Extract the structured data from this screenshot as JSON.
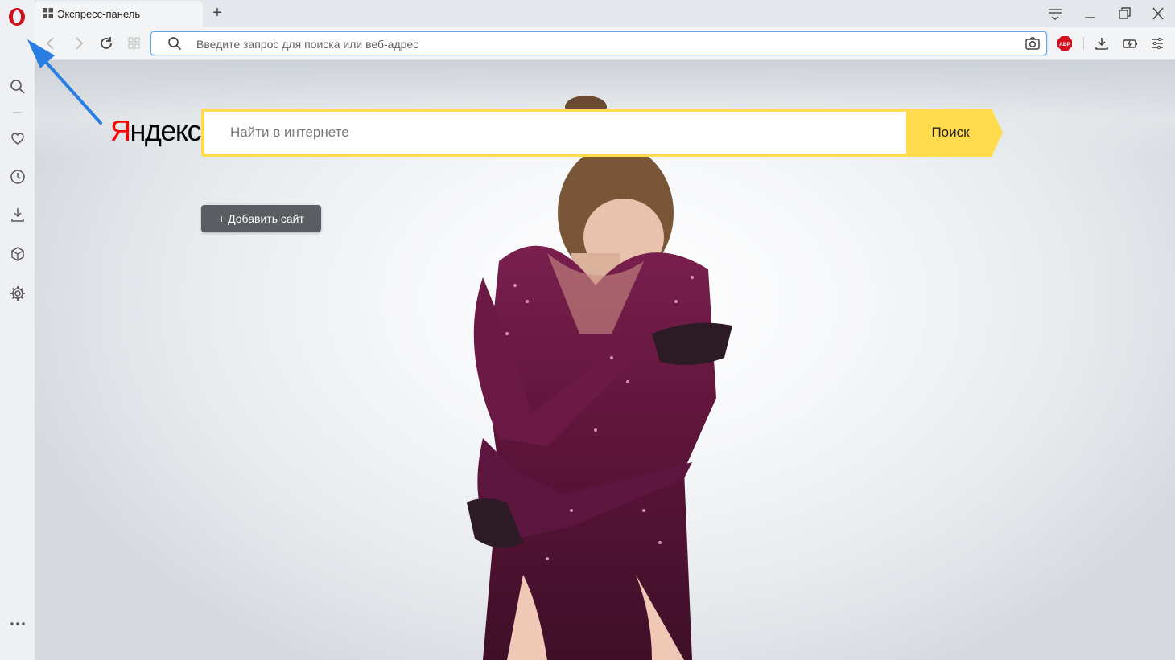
{
  "browser": {
    "tab": {
      "title": "Экспресс-панель",
      "icon": "grid-icon"
    },
    "new_tab_label": "+",
    "address_bar": {
      "value": "",
      "placeholder": "Введите запрос для поиска или веб-адрес"
    },
    "toolbar_icons": [
      "camera-icon",
      "adblock-icon",
      "download-icon",
      "battery-saver-icon",
      "easy-setup-icon"
    ],
    "adblock_badge": "ABP",
    "window_controls": [
      "tab-menu-icon",
      "minimize-icon",
      "restore-icon",
      "close-icon"
    ],
    "sidebar_icons": [
      "search-icon",
      "heart-icon",
      "history-icon",
      "downloads-icon",
      "extensions-icon",
      "settings-icon",
      "more-icon"
    ],
    "accent_color": "#d10f1f"
  },
  "speed_dial": {
    "logo": {
      "first": "Я",
      "rest": "ндекс"
    },
    "search": {
      "placeholder": "Найти в интернете",
      "button_label": "Поиск"
    },
    "add_site_label": "+ Добавить сайт",
    "colors": {
      "search_border": "#ffdb4d",
      "logo_red": "#ff0000"
    }
  }
}
